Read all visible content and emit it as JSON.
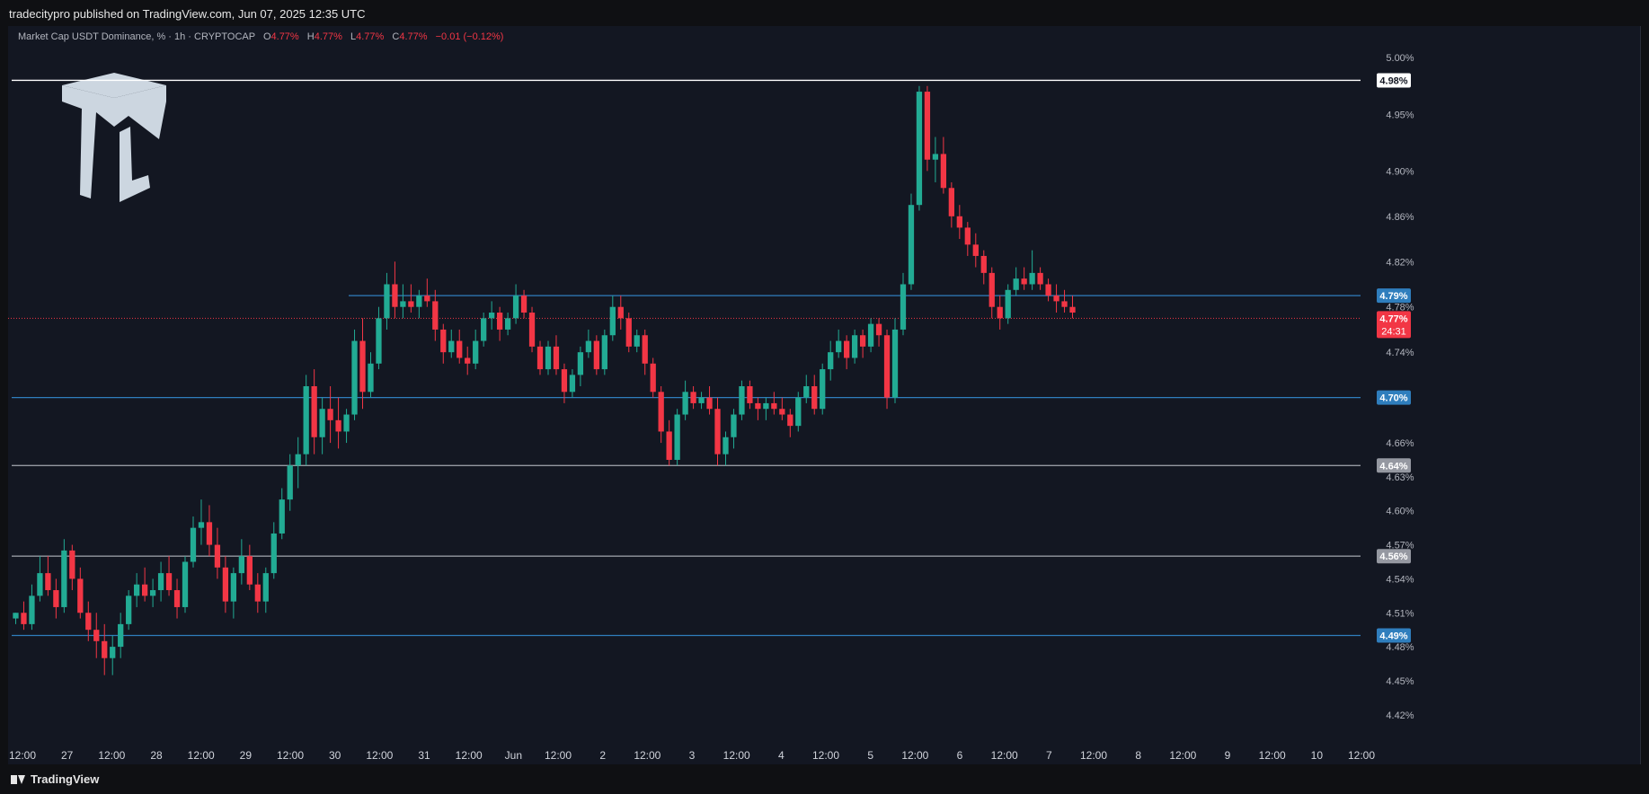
{
  "header": {
    "published": "tradecitypro published on TradingView.com, Jun 07, 2025 12:35 UTC"
  },
  "legend": {
    "title": "Market Cap USDT Dominance, % · 1h · CRYPTOCAP",
    "open_label": "O",
    "open": "4.77%",
    "high_label": "H",
    "high": "4.77%",
    "low_label": "L",
    "low": "4.77%",
    "close_label": "C",
    "close": "4.77%",
    "change": "−0.01 (−0.12%)"
  },
  "footer": {
    "brand": "TradingView"
  },
  "colors": {
    "up": "#22ab94",
    "down": "#f23645",
    "level": "#2962ff",
    "background": "#131722"
  },
  "chart_data": {
    "type": "candlestick",
    "ylim": [
      4.4,
      5.02
    ],
    "xlim": [
      0,
      152
    ],
    "y_ticks": [
      "5.00%",
      "4.95%",
      "4.90%",
      "4.86%",
      "4.82%",
      "4.78%",
      "4.74%",
      "4.66%",
      "4.63%",
      "4.60%",
      "4.57%",
      "4.54%",
      "4.51%",
      "4.48%",
      "4.45%",
      "4.42%"
    ],
    "y_tick_values": [
      5.0,
      4.95,
      4.9,
      4.86,
      4.82,
      4.78,
      4.74,
      4.66,
      4.63,
      4.6,
      4.57,
      4.54,
      4.51,
      4.48,
      4.45,
      4.42
    ],
    "x_ticks": [
      "12:00",
      "27",
      "12:00",
      "28",
      "12:00",
      "29",
      "12:00",
      "30",
      "12:00",
      "31",
      "12:00",
      "Jun",
      "12:00",
      "2",
      "12:00",
      "3",
      "12:00",
      "4",
      "12:00",
      "5",
      "12:00",
      "6",
      "12:00",
      "7",
      "12:00",
      "8",
      "12:00",
      "9",
      "12:00",
      "10",
      "12:00"
    ],
    "levels": [
      {
        "label": "4.98%",
        "value": 4.98,
        "color": "#ffffff",
        "label_bg": "#ffffff",
        "label_fg": "#131722",
        "x_start": 0
      },
      {
        "label": "4.79%",
        "value": 4.79,
        "color": "#2f7ebd",
        "label_bg": "#2f7ebd",
        "label_fg": "#ffffff",
        "x_start": 38
      },
      {
        "label": "4.70%",
        "value": 4.7,
        "color": "#2f7ebd",
        "label_bg": "#2f7ebd",
        "label_fg": "#ffffff",
        "x_start": 0
      },
      {
        "label": "4.64%",
        "value": 4.64,
        "color": "#9598a1",
        "label_bg": "#9598a1",
        "label_fg": "#ffffff",
        "x_start": 0
      },
      {
        "label": "4.56%",
        "value": 4.56,
        "color": "#9598a1",
        "label_bg": "#9598a1",
        "label_fg": "#ffffff",
        "x_start": 0
      },
      {
        "label": "4.49%",
        "value": 4.49,
        "color": "#2f7ebd",
        "label_bg": "#2f7ebd",
        "label_fg": "#ffffff",
        "x_start": 0
      }
    ],
    "current_price": {
      "value": 4.77,
      "label": "4.77%",
      "countdown": "24:31",
      "color": "#f23645"
    },
    "candles": [
      [
        4.505,
        4.51,
        4.5,
        4.51
      ],
      [
        4.51,
        4.52,
        4.495,
        4.5
      ],
      [
        4.5,
        4.535,
        4.495,
        4.525
      ],
      [
        4.525,
        4.56,
        4.52,
        4.545
      ],
      [
        4.545,
        4.56,
        4.525,
        4.53
      ],
      [
        4.53,
        4.54,
        4.505,
        4.515
      ],
      [
        4.515,
        4.575,
        4.51,
        4.565
      ],
      [
        4.565,
        4.57,
        4.53,
        4.54
      ],
      [
        4.54,
        4.55,
        4.505,
        4.51
      ],
      [
        4.51,
        4.52,
        4.485,
        4.495
      ],
      [
        4.495,
        4.51,
        4.47,
        4.485
      ],
      [
        4.485,
        4.5,
        4.455,
        4.47
      ],
      [
        4.47,
        4.49,
        4.455,
        4.48
      ],
      [
        4.48,
        4.51,
        4.47,
        4.5
      ],
      [
        4.5,
        4.53,
        4.495,
        4.525
      ],
      [
        4.525,
        4.545,
        4.515,
        4.535
      ],
      [
        4.535,
        4.55,
        4.52,
        4.525
      ],
      [
        4.525,
        4.54,
        4.515,
        4.53
      ],
      [
        4.53,
        4.555,
        4.52,
        4.545
      ],
      [
        4.545,
        4.56,
        4.525,
        4.53
      ],
      [
        4.53,
        4.54,
        4.505,
        4.515
      ],
      [
        4.515,
        4.56,
        4.51,
        4.555
      ],
      [
        4.555,
        4.595,
        4.55,
        4.585
      ],
      [
        4.585,
        4.61,
        4.57,
        4.59
      ],
      [
        4.59,
        4.605,
        4.56,
        4.57
      ],
      [
        4.57,
        4.585,
        4.54,
        4.55
      ],
      [
        4.55,
        4.56,
        4.51,
        4.52
      ],
      [
        4.52,
        4.55,
        4.505,
        4.545
      ],
      [
        4.545,
        4.575,
        4.535,
        4.56
      ],
      [
        4.56,
        4.57,
        4.53,
        4.535
      ],
      [
        4.535,
        4.545,
        4.51,
        4.52
      ],
      [
        4.52,
        4.55,
        4.51,
        4.545
      ],
      [
        4.545,
        4.59,
        4.54,
        4.58
      ],
      [
        4.58,
        4.62,
        4.575,
        4.61
      ],
      [
        4.61,
        4.65,
        4.6,
        4.64
      ],
      [
        4.64,
        4.665,
        4.62,
        4.65
      ],
      [
        4.65,
        4.72,
        4.64,
        4.71
      ],
      [
        4.71,
        4.725,
        4.65,
        4.665
      ],
      [
        4.665,
        4.7,
        4.65,
        4.69
      ],
      [
        4.69,
        4.71,
        4.66,
        4.68
      ],
      [
        4.68,
        4.7,
        4.655,
        4.67
      ],
      [
        4.67,
        4.69,
        4.66,
        4.685
      ],
      [
        4.685,
        4.76,
        4.68,
        4.75
      ],
      [
        4.75,
        4.77,
        4.69,
        4.705
      ],
      [
        4.705,
        4.74,
        4.7,
        4.73
      ],
      [
        4.73,
        4.78,
        4.725,
        4.77
      ],
      [
        4.77,
        4.81,
        4.76,
        4.8
      ],
      [
        4.8,
        4.82,
        4.77,
        4.78
      ],
      [
        4.78,
        4.8,
        4.77,
        4.785
      ],
      [
        4.785,
        4.8,
        4.775,
        4.78
      ],
      [
        4.78,
        4.795,
        4.77,
        4.79
      ],
      [
        4.79,
        4.805,
        4.78,
        4.785
      ],
      [
        4.785,
        4.795,
        4.75,
        4.76
      ],
      [
        4.76,
        4.765,
        4.73,
        4.74
      ],
      [
        4.74,
        4.76,
        4.735,
        4.75
      ],
      [
        4.75,
        4.76,
        4.73,
        4.735
      ],
      [
        4.735,
        4.745,
        4.72,
        4.73
      ],
      [
        4.73,
        4.76,
        4.725,
        4.75
      ],
      [
        4.75,
        4.775,
        4.745,
        4.77
      ],
      [
        4.77,
        4.785,
        4.76,
        4.775
      ],
      [
        4.775,
        4.78,
        4.75,
        4.76
      ],
      [
        4.76,
        4.775,
        4.755,
        4.77
      ],
      [
        4.77,
        4.8,
        4.765,
        4.79
      ],
      [
        4.79,
        4.795,
        4.77,
        4.775
      ],
      [
        4.775,
        4.78,
        4.74,
        4.745
      ],
      [
        4.745,
        4.75,
        4.72,
        4.725
      ],
      [
        4.725,
        4.75,
        4.72,
        4.745
      ],
      [
        4.745,
        4.755,
        4.72,
        4.725
      ],
      [
        4.725,
        4.73,
        4.695,
        4.705
      ],
      [
        4.705,
        4.725,
        4.7,
        4.72
      ],
      [
        4.72,
        4.745,
        4.71,
        4.74
      ],
      [
        4.74,
        4.76,
        4.735,
        4.75
      ],
      [
        4.75,
        4.755,
        4.72,
        4.725
      ],
      [
        4.725,
        4.76,
        4.72,
        4.755
      ],
      [
        4.755,
        4.79,
        4.75,
        4.78
      ],
      [
        4.78,
        4.79,
        4.76,
        4.77
      ],
      [
        4.77,
        4.775,
        4.74,
        4.745
      ],
      [
        4.745,
        4.76,
        4.74,
        4.755
      ],
      [
        4.755,
        4.76,
        4.72,
        4.73
      ],
      [
        4.73,
        4.735,
        4.7,
        4.705
      ],
      [
        4.705,
        4.71,
        4.66,
        4.67
      ],
      [
        4.67,
        4.68,
        4.64,
        4.645
      ],
      [
        4.645,
        4.69,
        4.64,
        4.685
      ],
      [
        4.685,
        4.715,
        4.68,
        4.705
      ],
      [
        4.705,
        4.71,
        4.69,
        4.695
      ],
      [
        4.695,
        4.705,
        4.69,
        4.7
      ],
      [
        4.7,
        4.71,
        4.685,
        4.69
      ],
      [
        4.69,
        4.7,
        4.64,
        4.65
      ],
      [
        4.65,
        4.67,
        4.64,
        4.665
      ],
      [
        4.665,
        4.69,
        4.655,
        4.685
      ],
      [
        4.685,
        4.715,
        4.68,
        4.71
      ],
      [
        4.71,
        4.715,
        4.69,
        4.695
      ],
      [
        4.695,
        4.7,
        4.68,
        4.69
      ],
      [
        4.69,
        4.7,
        4.68,
        4.695
      ],
      [
        4.695,
        4.705,
        4.685,
        4.69
      ],
      [
        4.69,
        4.7,
        4.68,
        4.685
      ],
      [
        4.685,
        4.69,
        4.665,
        4.675
      ],
      [
        4.675,
        4.705,
        4.67,
        4.7
      ],
      [
        4.7,
        4.72,
        4.695,
        4.71
      ],
      [
        4.71,
        4.72,
        4.685,
        4.69
      ],
      [
        4.69,
        4.73,
        4.685,
        4.725
      ],
      [
        4.725,
        4.75,
        4.715,
        4.74
      ],
      [
        4.74,
        4.76,
        4.735,
        4.75
      ],
      [
        4.75,
        4.755,
        4.725,
        4.735
      ],
      [
        4.735,
        4.76,
        4.73,
        4.755
      ],
      [
        4.755,
        4.76,
        4.735,
        4.745
      ],
      [
        4.745,
        4.77,
        4.74,
        4.765
      ],
      [
        4.765,
        4.77,
        4.745,
        4.755
      ],
      [
        4.755,
        4.76,
        4.69,
        4.7
      ],
      [
        4.7,
        4.77,
        4.695,
        4.76
      ],
      [
        4.76,
        4.81,
        4.755,
        4.8
      ],
      [
        4.8,
        4.88,
        4.795,
        4.87
      ],
      [
        4.87,
        4.975,
        4.865,
        4.97
      ],
      [
        4.97,
        4.975,
        4.9,
        4.91
      ],
      [
        4.91,
        4.93,
        4.89,
        4.915
      ],
      [
        4.915,
        4.93,
        4.88,
        4.885
      ],
      [
        4.885,
        4.89,
        4.85,
        4.86
      ],
      [
        4.86,
        4.87,
        4.84,
        4.85
      ],
      [
        4.85,
        4.855,
        4.825,
        4.835
      ],
      [
        4.835,
        4.845,
        4.815,
        4.825
      ],
      [
        4.825,
        4.83,
        4.8,
        4.81
      ],
      [
        4.81,
        4.815,
        4.77,
        4.78
      ],
      [
        4.78,
        4.79,
        4.76,
        4.77
      ],
      [
        4.77,
        4.8,
        4.765,
        4.795
      ],
      [
        4.795,
        4.815,
        4.79,
        4.805
      ],
      [
        4.805,
        4.815,
        4.795,
        4.8
      ],
      [
        4.8,
        4.83,
        4.795,
        4.81
      ],
      [
        4.81,
        4.815,
        4.795,
        4.8
      ],
      [
        4.8,
        4.805,
        4.785,
        4.79
      ],
      [
        4.79,
        4.8,
        4.775,
        4.785
      ],
      [
        4.785,
        4.795,
        4.775,
        4.78
      ],
      [
        4.78,
        4.79,
        4.77,
        4.775
      ]
    ]
  }
}
